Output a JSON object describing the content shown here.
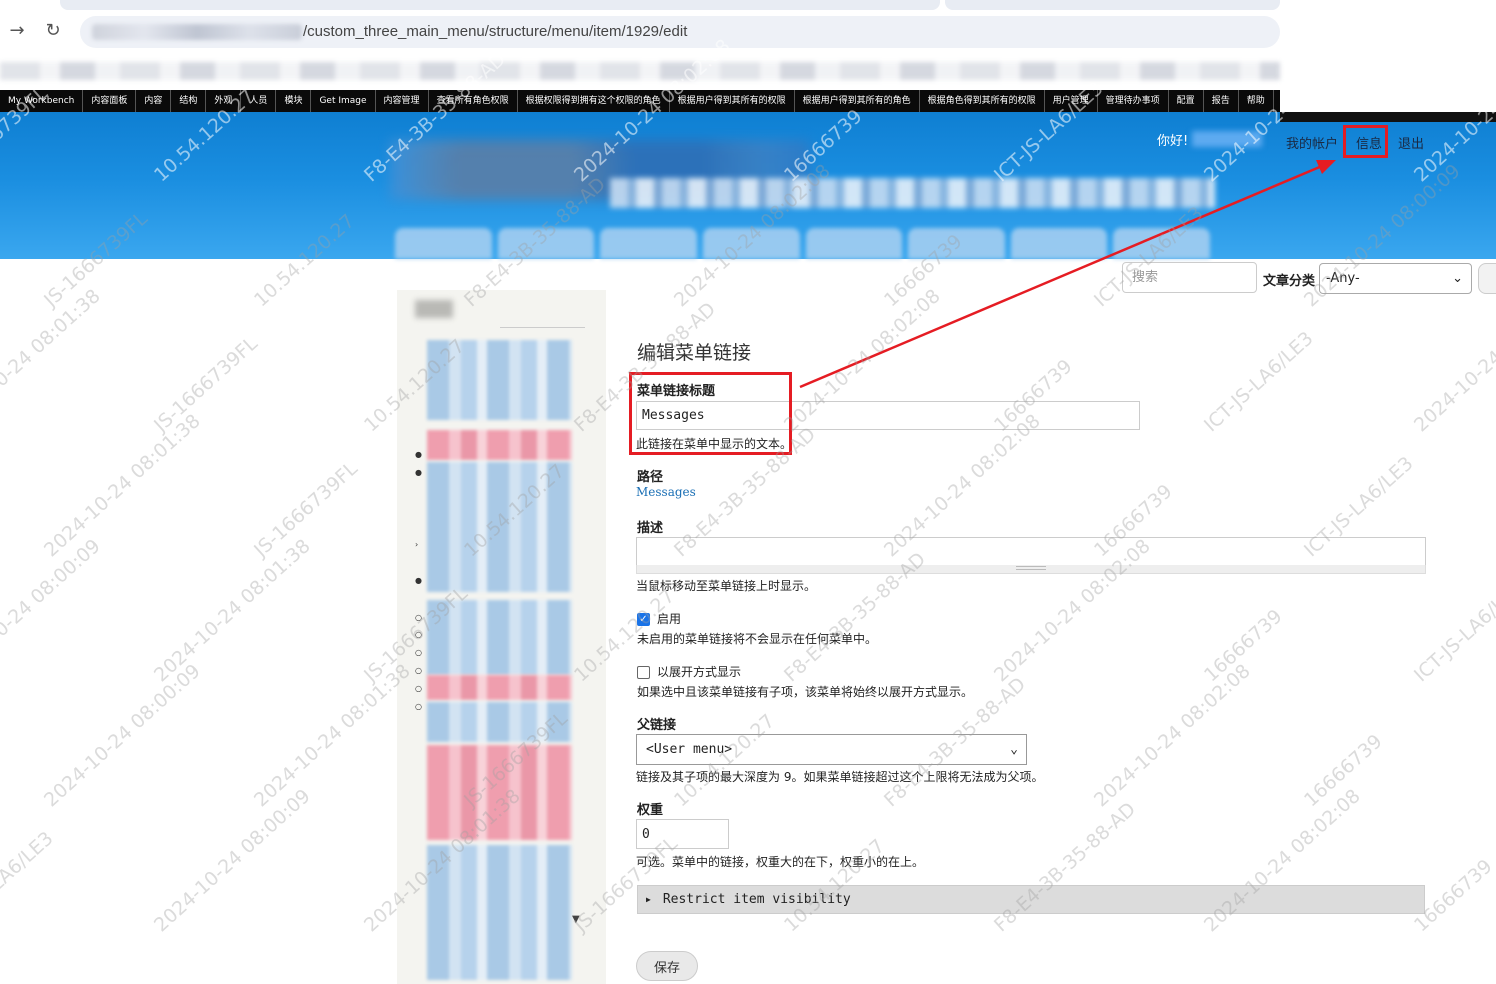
{
  "browser": {
    "url_suffix": "/custom_three_main_menu/structure/menu/item/1929/edit",
    "back_icon": "arrow-right-icon",
    "reload_icon": "reload-icon"
  },
  "admin_toolbar": {
    "items": [
      "My Workbench",
      "内容面板",
      "内容",
      "结构",
      "外观",
      "人员",
      "模块",
      "Get Image",
      "内容管理",
      "查看所有角色权限",
      "根据权限得到拥有这个权限的角色",
      "根据用户得到其所有的权限",
      "根据用户得到其所有的角色",
      "根据角色得到其所有的权限",
      "用户管理",
      "管理待办事项",
      "配置",
      "报告",
      "帮助"
    ]
  },
  "header": {
    "greeting": "你好!",
    "my_account": "我的帐户",
    "messages": "信息",
    "logout": "退出"
  },
  "search": {
    "placeholder": "搜索",
    "category_label": "文章分类",
    "category_value": "-Any-"
  },
  "form": {
    "page_title": "编辑菜单链接",
    "title_label": "菜单链接标题",
    "title_value": "Messages",
    "title_help": "此链接在菜单中显示的文本。",
    "path_label": "路径",
    "path_value": "Messages",
    "description_label": "描述",
    "description_help": "当鼠标移动至菜单链接上时显示。",
    "enabled_label": "启用",
    "enabled_help": "未启用的菜单链接将不会显示在任何菜单中。",
    "expanded_label": "以展开方式显示",
    "expanded_help": "如果选中且该菜单链接有子项，该菜单将始终以展开方式显示。",
    "parent_label": "父链接",
    "parent_value": "<User menu>",
    "parent_help": "链接及其子项的最大深度为 9。如果菜单链接超过这个上限将无法成为父项。",
    "weight_label": "权重",
    "weight_value": "0",
    "weight_help": "可选。菜单中的链接，权重大的在下，权重小的在上。",
    "visibility_label": "Restrict item visibility",
    "save_label": "保存"
  },
  "annotation_color": "#e51c23",
  "watermarks": [
    "JS-1666739FL",
    "10.54.120.27",
    "F8-E4-3B-35-88-AD",
    "2024-10-24 08:02:08",
    "16666739",
    "ICT-JS-LA6/LE3",
    "2024-10-24 08:00:09",
    "2024-10-24 08:01:38"
  ]
}
